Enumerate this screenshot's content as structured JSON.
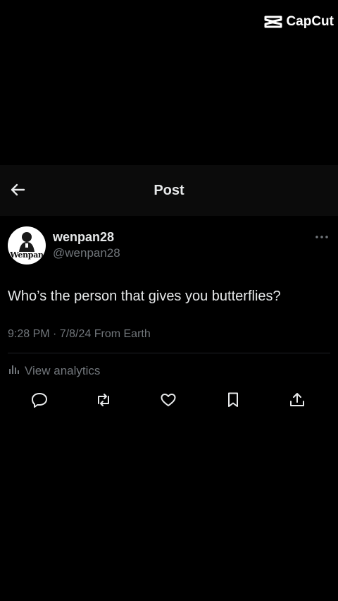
{
  "watermark": {
    "brand": "CapCut",
    "icon": "capcut-logo-icon"
  },
  "header": {
    "title": "Post",
    "back_icon": "arrow-left-icon"
  },
  "author": {
    "display_name": "wenpan28",
    "handle": "@wenpan28",
    "avatar_text": "Wenpan"
  },
  "post": {
    "text": "Who’s the person that gives you butterflies?",
    "meta": "9:28 PM · 7/8/24 From Earth"
  },
  "analytics": {
    "label": "View analytics",
    "icon": "analytics-bars-icon"
  },
  "actions": [
    {
      "name": "reply",
      "icon": "reply-icon"
    },
    {
      "name": "repost",
      "icon": "repost-icon"
    },
    {
      "name": "like",
      "icon": "heart-icon"
    },
    {
      "name": "bookmark",
      "icon": "bookmark-icon"
    },
    {
      "name": "share",
      "icon": "share-icon"
    }
  ],
  "colors": {
    "background": "#000000",
    "header_bg": "#0b0b0b",
    "primary_text": "#e7e9ea",
    "secondary_text": "#71767b",
    "divider": "#1f2226"
  }
}
